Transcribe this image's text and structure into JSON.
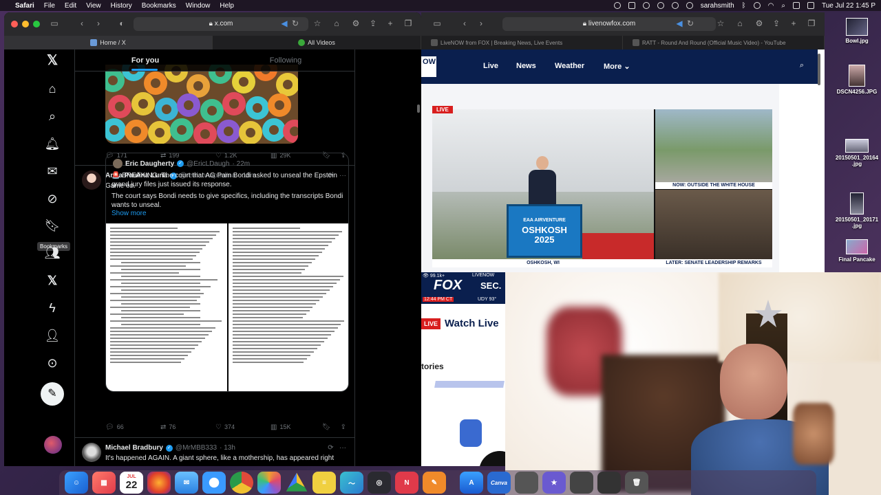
{
  "menubar": {
    "app": "Safari",
    "items": [
      "File",
      "Edit",
      "View",
      "History",
      "Bookmarks",
      "Window",
      "Help"
    ],
    "user": "sarahsmith",
    "datetime": "Tue Jul 22  1:45 P"
  },
  "window1": {
    "url": "x.com",
    "tabs": [
      {
        "label": "Home / X"
      },
      {
        "label": "All Videos"
      }
    ]
  },
  "x": {
    "tabs": {
      "for_you": "For you",
      "following": "Following"
    },
    "tooltip": "Bookmarks",
    "post1_stats": {
      "replies": "171",
      "reposts": "199",
      "likes": "1.2K",
      "views": "29K"
    },
    "post2": {
      "name": "Anna Paulina Luna",
      "handle": "@realannapaulina",
      "time": "· 18m",
      "text": "Game on.",
      "quote": {
        "name": "Eric Daugherty",
        "handle": "@EricLDaugh",
        "time": "· 22m",
        "text1": "🚨 BREAKING: The court that AG Pam Bondi asked to unseal the Epstein grand jury files just issued its response.",
        "text2": "The court says Bondi needs to give specifics, including the transcripts Bondi wants to unseal.",
        "show_more": "Show more"
      },
      "stats": {
        "replies": "66",
        "reposts": "76",
        "likes": "374",
        "views": "15K"
      }
    },
    "post3": {
      "name": "Michael Bradbury",
      "handle": "@MrMBB333",
      "time": "· 13h",
      "text": "It's happened AGAIN. A giant sphere, like a mothership, has appeared right"
    }
  },
  "window2": {
    "url": "livenowfox.com",
    "tabs": [
      {
        "label": "LiveNOW from FOX | Breaking News, Live Events"
      },
      {
        "label": "RATT - Round And Round (Official Music Video) - YouTube"
      }
    ],
    "logo": "OW",
    "nav": [
      "Live",
      "News",
      "Weather",
      "More"
    ],
    "live_tag": "LIVE",
    "podium_line1": "EAA AIRVENTURE",
    "podium_line2": "OSHKOSH",
    "podium_line3": "2025",
    "cap_main": "OSHKOSH, WI",
    "cap_side1": "NOW: OUTSIDE THE WHITE HOUSE",
    "cap_side2": "LATER: SENATE LEADERSHIP REMARKS"
  },
  "fox_bottom": {
    "viewers": "99.1k+",
    "network": "LIVENOW",
    "brand": "FOX",
    "sec": "SEC.",
    "time": "12:44 PM CT",
    "weather": "UDY 93°",
    "watch_badge": "LIVE",
    "watch_text": "Watch Live",
    "stories": "tories"
  },
  "desktop": [
    {
      "label": "Bowl.jpg"
    },
    {
      "label": "DSCN4256.JPG"
    },
    {
      "label": "20150501_20164 .jpg"
    },
    {
      "label": "20150501_20171 .jpg"
    },
    {
      "label": "Final Pancake"
    }
  ],
  "dock": {
    "calendar_month": "JUL",
    "calendar_day": "22"
  },
  "colors": {
    "x_blue": "#1d9bf0",
    "fox_navy": "#0a1f4e",
    "fox_red": "#d81e1e"
  }
}
